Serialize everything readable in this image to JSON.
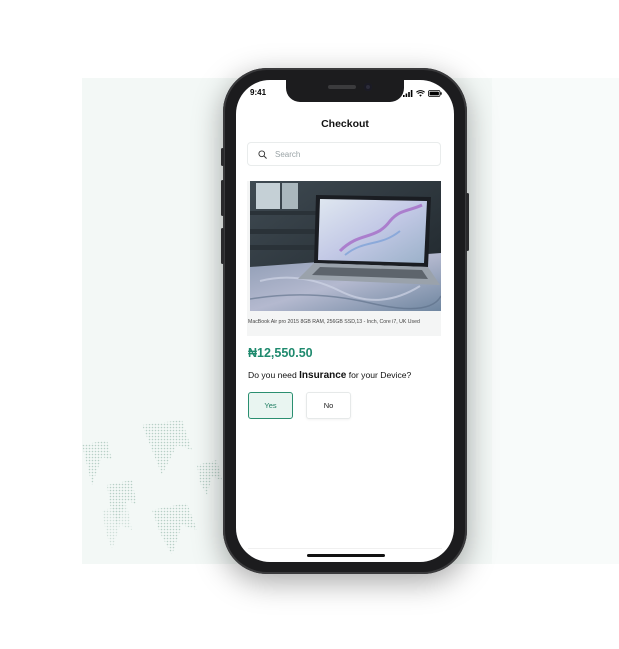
{
  "status_bar": {
    "time": "9:41"
  },
  "header": {
    "title": "Checkout"
  },
  "search": {
    "placeholder": "Search"
  },
  "product": {
    "name": "MacBook Air pro 2015 8GB RAM, 256GB SSD,13 - Inch, Core i7, UK Used",
    "price": "₦12,550.50"
  },
  "insurance": {
    "question_prefix": "Do you need",
    "question_bold": "Insurance",
    "question_suffix": "for your Device?",
    "options": [
      {
        "label": "Yes",
        "selected": true
      },
      {
        "label": "No",
        "selected": false
      }
    ]
  },
  "colors": {
    "accent": "#1f8a6e",
    "backdrop": "#f3f8f6",
    "phone_frame": "#1c1c1e"
  },
  "icons": [
    "search-icon",
    "signal-icon",
    "wifi-icon",
    "battery-icon"
  ]
}
